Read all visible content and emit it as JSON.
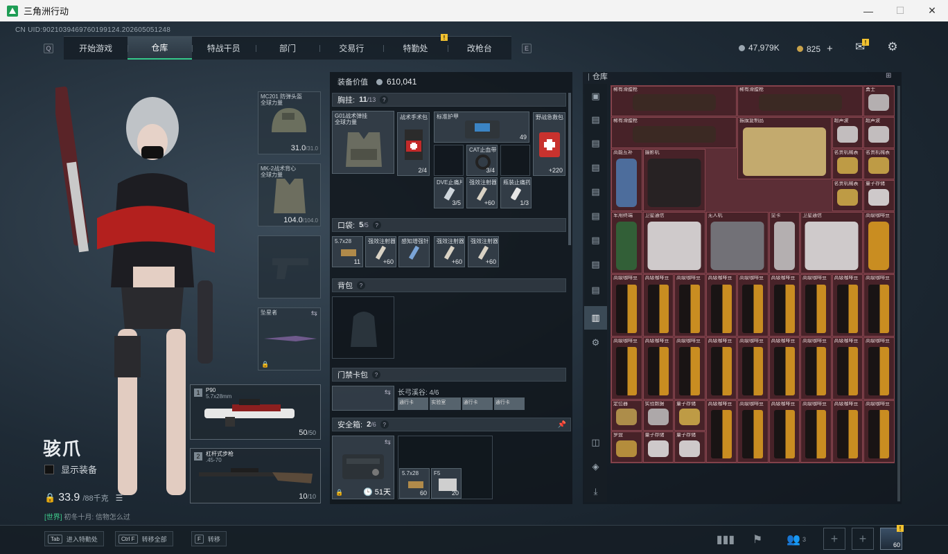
{
  "window": {
    "title": "三角洲行动",
    "minimize": "—",
    "maximize": "☐",
    "close": "✕"
  },
  "uid": "CN UID:9021039469760199124.202605051248",
  "nav": {
    "left_key": "Q",
    "right_key": "E",
    "tabs": [
      "开始游戏",
      "仓库",
      "特战干员",
      "部门",
      "交易行",
      "特勤处",
      "改枪台"
    ],
    "active": "仓库",
    "warn_tab": "特勤处"
  },
  "currency": {
    "silver": "47,979K",
    "gold": "825",
    "plus": "+"
  },
  "character": {
    "name": "骇爪",
    "show_equipment": "显示装备",
    "weight": "33.9",
    "weight_max": "/88千克",
    "chat_channel": "[世界]",
    "chat_text": "初冬十月: 信物怎么过"
  },
  "equipment": {
    "helmet": {
      "name": "MC201 防弹头盔",
      "sub": "全球力量",
      "dur": "31.0",
      "max": "/31.0"
    },
    "armor": {
      "name": "MK-2战术背心",
      "sub": "全球力量",
      "dur": "104.0",
      "max": "/104.0"
    },
    "melee": {
      "name": "坠星者"
    },
    "primary": {
      "slot": "1",
      "name": "P90",
      "caliber": "5.7x28mm",
      "ammo": "50",
      "ammo_max": "/50"
    },
    "secondary": {
      "slot": "2",
      "name": "杠杆式步枪",
      "caliber": ".45-70",
      "ammo": "10",
      "ammo_max": "/10"
    }
  },
  "middle": {
    "value_label": "装备价值",
    "value": "610,041",
    "chest": {
      "title": "胸挂:",
      "count": "11",
      "cap": "/13",
      "rig": "G01战术弹挂",
      "rig_sub": "全球力量",
      "items": [
        {
          "label": "战术手术包",
          "count": "2/4"
        },
        {
          "label": "标准护甲",
          "count": "49"
        },
        {
          "label": "野战急救包",
          "count": "+220"
        },
        {
          "label": "CAT止血带",
          "count": "3/4"
        },
        {
          "label": "DVE止痛片",
          "count": "3/5"
        },
        {
          "label": "强效注射器",
          "count": "+60"
        },
        {
          "label": "瓶装止痛药",
          "count": "1/3"
        }
      ]
    },
    "pocket": {
      "title": "口袋:",
      "count": "5",
      "cap": "/5",
      "items": [
        {
          "label": "5.7x28",
          "count": "11"
        },
        {
          "label": "强效注射器",
          "count": "+60"
        },
        {
          "label": "感知增强针",
          "count": ""
        },
        {
          "label": "强效注射器",
          "count": "+60"
        },
        {
          "label": "强效注射器",
          "count": "+60"
        }
      ]
    },
    "backpack": {
      "title": "背包"
    },
    "keycase": {
      "title": "门禁卡包",
      "location": "长弓溪谷: 4/6",
      "keys": [
        "通行卡",
        "实验室",
        "通行卡",
        "通行卡"
      ]
    },
    "safebox": {
      "title": "安全箱:",
      "count": "2",
      "cap": "/6",
      "timer": "51天",
      "items": [
        {
          "label": "5.7x28",
          "count": "60"
        },
        {
          "label": "F5",
          "count": "20"
        }
      ]
    }
  },
  "warehouse": {
    "title": "仓库",
    "items": [
      "稀有滑膛枪",
      "稀有滑膛枪",
      "勇士",
      "稀有滑膛枪",
      "振膜复制品",
      "超声波",
      "超声波",
      "高能互补",
      "摄影机",
      "名贵机械表",
      "名贵机械表",
      "名贵机械表",
      "量子存储",
      "军用终端",
      "卫星通信",
      "无人机",
      "显卡",
      "卫星通信",
      "高级咖啡豆",
      "高级咖啡豆",
      "定位器",
      "实验数据",
      "量子存储",
      "罗盘",
      "量子存储",
      "量子存储"
    ],
    "coffee": "高级咖啡豆"
  },
  "bottom": {
    "hints": [
      {
        "key": "Tab",
        "label": "进入特勤处"
      },
      {
        "key": "Ctrl F",
        "label": "转移全部"
      },
      {
        "key": "F",
        "label": "转移"
      }
    ],
    "squad_count": "3",
    "badge": "60"
  },
  "colors": {
    "accent": "#35c98a",
    "warehouse_bg": "#5c2e36",
    "warn": "#f2c230"
  }
}
